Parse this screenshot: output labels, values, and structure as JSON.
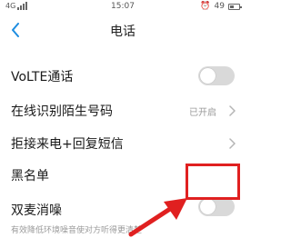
{
  "status_bar": {
    "network": "4G",
    "time": "15:07",
    "battery_percent": "49"
  },
  "header": {
    "title": "电话"
  },
  "settings": [
    {
      "label": "VoLTE通话",
      "control": "toggle",
      "enabled": false
    },
    {
      "label": "在线识别陌生号码",
      "value": "已开启",
      "control": "chevron"
    },
    {
      "label": "拒接来电+回复短信",
      "control": "chevron"
    },
    {
      "label": "黑名单",
      "control": "none"
    },
    {
      "label": "双麦消噪",
      "control": "toggle",
      "enabled": false,
      "description": "有效降低环境噪音使对方听得更清楚"
    }
  ],
  "annotation": {
    "highlight_color": "#e02020"
  },
  "colors": {
    "toggle_off": "#d9d9d9",
    "back_arrow": "#1e8de0"
  }
}
